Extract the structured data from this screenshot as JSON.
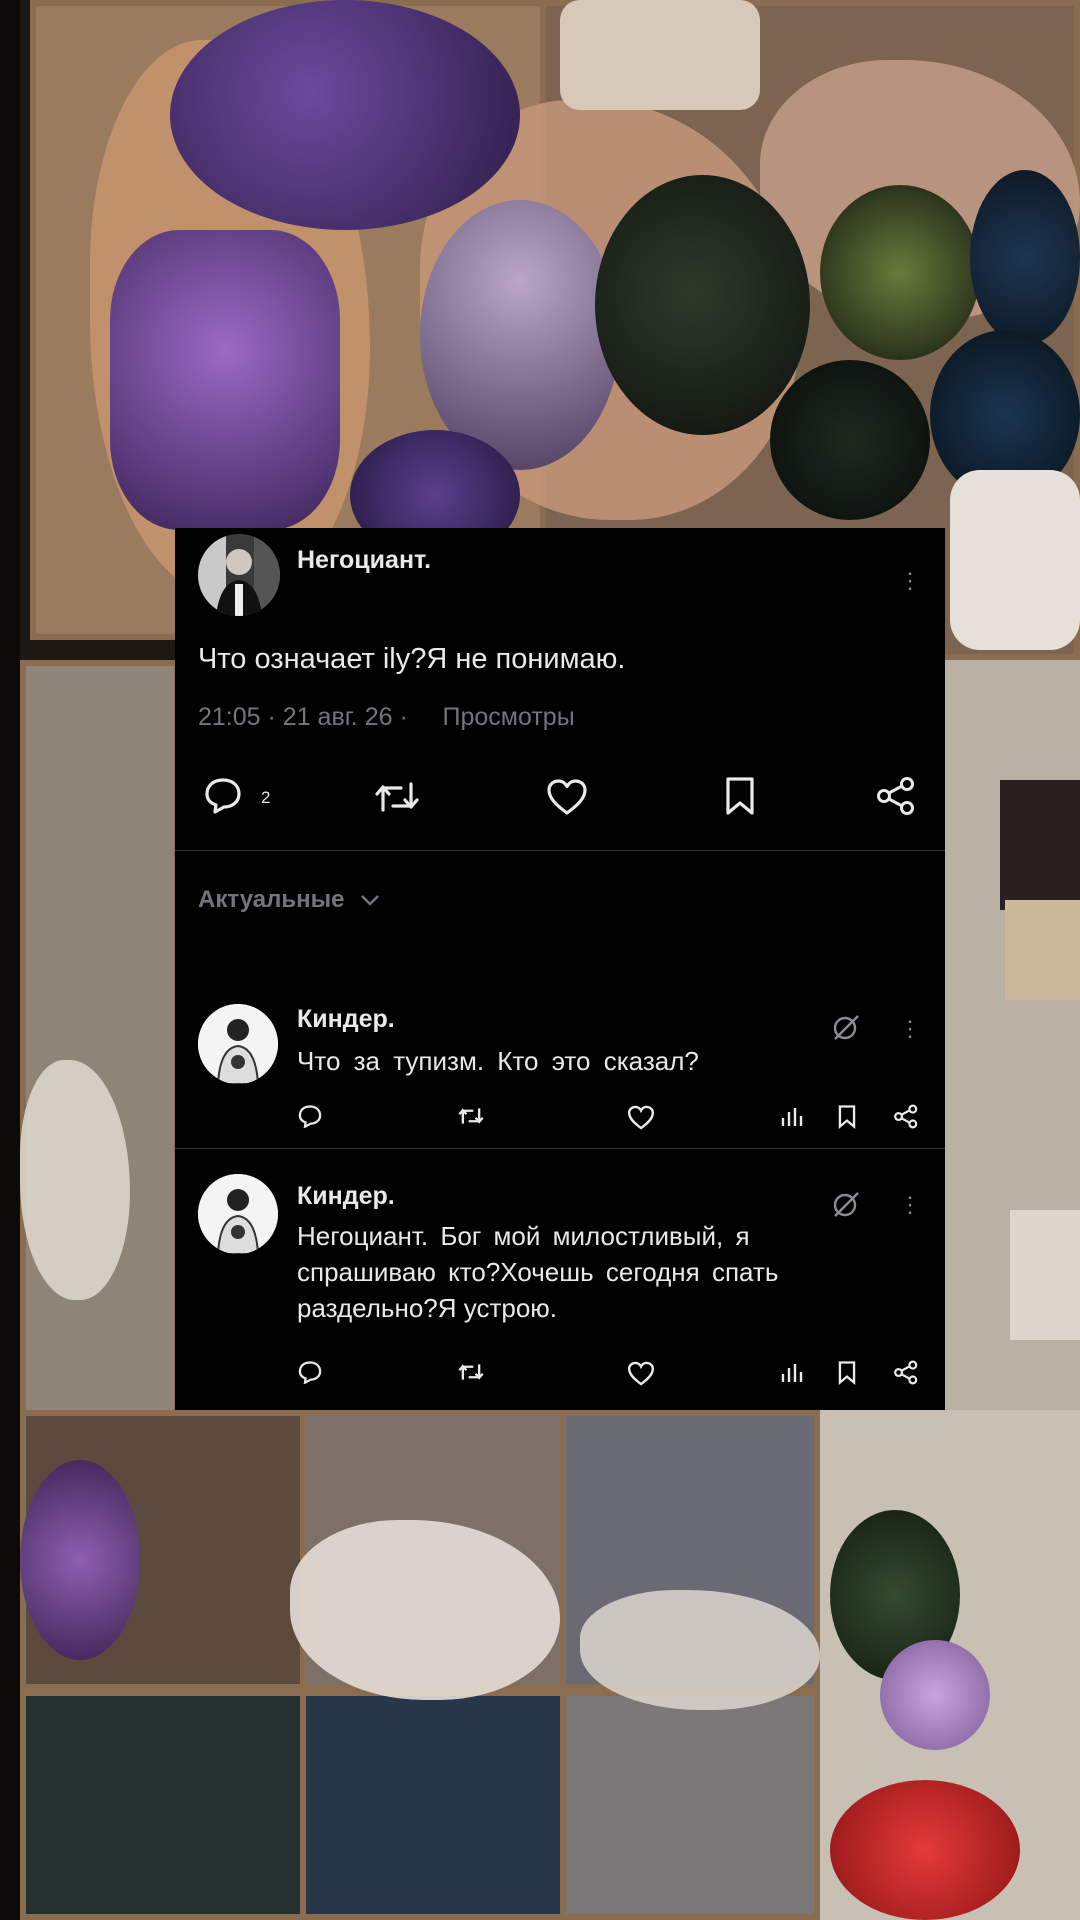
{
  "post": {
    "author": "Негоциант.",
    "text": "Что означает ily?Я не понимаю.",
    "time": "21:05",
    "date": "21 авг. 26",
    "views_label": "Просмотры",
    "reply_count": "2"
  },
  "sort": {
    "label": "Актуальные"
  },
  "replies": [
    {
      "author": "Киндер.",
      "text": "Что за тупизм. Кто это сказал?"
    },
    {
      "author": "Киндер.",
      "text_line1": "Негоциант. Бог мой милостливый, я",
      "text_line2": "спрашиваю кто?Хочешь сегодня спать",
      "text_line3": "раздельно?Я устрою."
    }
  ],
  "icons": [
    "reply-icon",
    "repost-icon",
    "like-icon",
    "bookmark-icon",
    "share-icon",
    "views-icon",
    "grok-icon",
    "more-icon",
    "chevron-down-icon"
  ],
  "colors": {
    "card": "#000000",
    "text": "#e7e9ea",
    "muted": "#71767b",
    "divider": "#2f3336"
  }
}
